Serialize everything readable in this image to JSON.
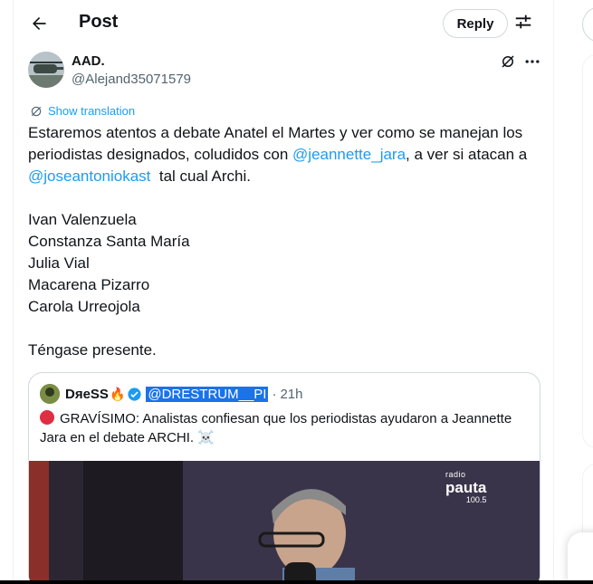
{
  "header": {
    "title": "Post",
    "reply_label": "Reply"
  },
  "post": {
    "author_name": "AAD.",
    "author_handle": "@Alejand35071579",
    "show_translation": "Show translation",
    "lines": {
      "l1": "Estaremos atentos a debate Anatel el Martes y ver como se manejan los",
      "l2_pre": "periodistas designados, coludidos con ",
      "l2_mention": "@jeannette_jara",
      "l2_post": ", a ver si atacan a",
      "l3_mention": "@joseantoniokast",
      "l3_post": "  tal cual Archi.",
      "names": [
        "Ivan Valenzuela",
        "Constanza Santa María",
        "Julia Vial",
        "Macarena Pizarro",
        "Carola Urreojola"
      ],
      "closing": "Téngase presente."
    }
  },
  "quote": {
    "name": "DяeSS",
    "fire": "🔥",
    "handle": "@DRESTRUM__PI",
    "dot": "·",
    "time": "21h",
    "text": "GRAVÍSIMO: Analistas confiesan que los periodistas ayudaron a Jeannette Jara en el debate ARCHI. ☠️",
    "media_logo_small": "radio",
    "media_logo_name": "pauta",
    "media_logo_freq": "100.5"
  },
  "colors": {
    "accent": "#1d9bf0",
    "text": "#0f1419",
    "secondary": "#536471",
    "border": "#cfd9de"
  },
  "icons": [
    "back-arrow-icon",
    "adjust-icon",
    "grok-icon",
    "more-icon",
    "translate-icon",
    "verified-icon",
    "red-circle-icon"
  ]
}
